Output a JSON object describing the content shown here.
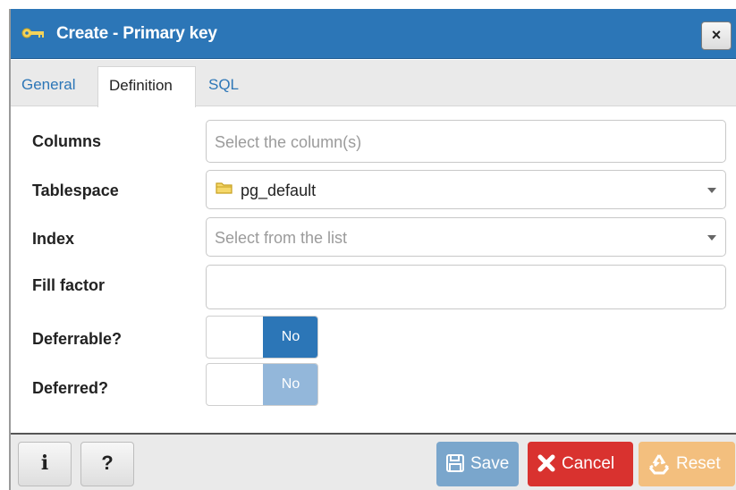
{
  "dialog": {
    "title": "Create - Primary key",
    "close_label": "×"
  },
  "tabs": [
    {
      "label": "General"
    },
    {
      "label": "Definition"
    },
    {
      "label": "SQL"
    }
  ],
  "form": {
    "columns": {
      "label": "Columns",
      "placeholder": "Select the column(s)"
    },
    "tablespace": {
      "label": "Tablespace",
      "value": "pg_default"
    },
    "index": {
      "label": "Index",
      "placeholder": "Select from the list"
    },
    "fill_factor": {
      "label": "Fill factor",
      "value": ""
    },
    "deferrable": {
      "label": "Deferrable?",
      "value": "No"
    },
    "deferred": {
      "label": "Deferred?",
      "value": "No"
    }
  },
  "footer": {
    "info_label": "i",
    "help_label": "?",
    "save_label": "Save",
    "cancel_label": "Cancel",
    "reset_label": "Reset"
  },
  "colors": {
    "accent": "#2c76b7",
    "cancel": "#d9322f",
    "reset": "#f3bf7e",
    "save_disabled": "#7aa6cc"
  },
  "icons": [
    "key-icon",
    "close-icon",
    "folder-icon",
    "caret-down-icon",
    "save-icon",
    "close-x-icon",
    "recycle-icon"
  ]
}
